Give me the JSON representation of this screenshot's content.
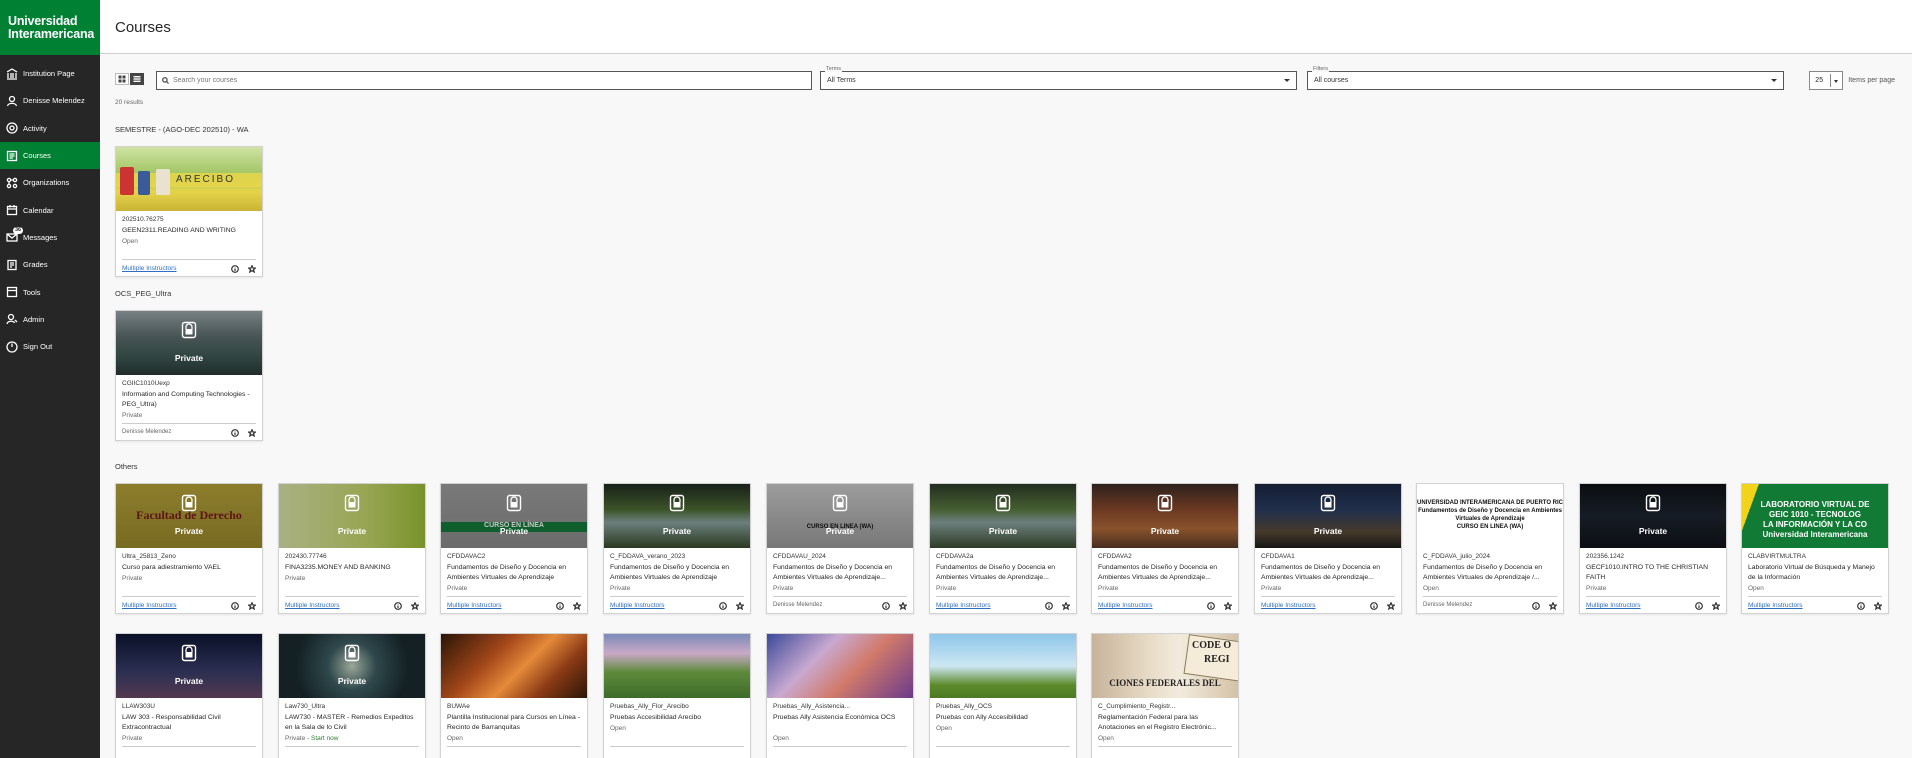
{
  "brand": {
    "line1": "Universidad",
    "line2": "Interamericana"
  },
  "nav": [
    {
      "label": "Institution Page",
      "icon": "institution-icon"
    },
    {
      "label": "Denisse Melendez",
      "icon": "user-icon"
    },
    {
      "label": "Activity",
      "icon": "activity-icon"
    },
    {
      "label": "Courses",
      "icon": "courses-icon",
      "active": true
    },
    {
      "label": "Organizations",
      "icon": "organizations-icon"
    },
    {
      "label": "Calendar",
      "icon": "calendar-icon"
    },
    {
      "label": "Messages",
      "icon": "messages-icon",
      "badge": "36"
    },
    {
      "label": "Grades",
      "icon": "grades-icon"
    },
    {
      "label": "Tools",
      "icon": "tools-icon"
    },
    {
      "label": "Admin",
      "icon": "admin-icon"
    },
    {
      "label": "Sign Out",
      "icon": "sign-out-icon"
    }
  ],
  "header": {
    "title": "Courses"
  },
  "toolbar": {
    "search_placeholder": "Search your courses",
    "terms_label": "Terms",
    "terms_value": "All Terms",
    "filters_label": "Filters",
    "filters_value": "All courses",
    "per_page_value": "25",
    "per_page_label": "Items per page"
  },
  "results": "20 results",
  "sections": {
    "s1": "SEMESTRE - (AGO-DEC 202510) - WA",
    "s2": "OCS_PEG_Ultra",
    "s3": "Others"
  },
  "private_label": "Private",
  "courses": [
    {
      "id": "202510.76275",
      "name": "GEEN2311.READING AND WRITING",
      "status": "Open",
      "instructor": "Multiple Instructors",
      "thumb_text": "ARECIBO"
    },
    {
      "id": "CGIIC1010Uexp",
      "name": "Information and Computing Technologies - PEG_Ultra)",
      "status": "Private",
      "instructor": "Denisse Melendez"
    },
    {
      "id": "Ultra_25813_Zeno",
      "name": "Curso para adiestramiento VAEL",
      "status": "Private",
      "instructor": "Multiple Instructors",
      "thumb_text": "Facultad de Derecho"
    },
    {
      "id": "202430.77746",
      "name": "FINA3235.MONEY AND BANKING",
      "status": "Private",
      "instructor": "Multiple Instructors"
    },
    {
      "id": "CFDDAVAC2",
      "name": "Fundamentos de Diseño y Docencia en Ambientes Virtuales de Aprendizaje",
      "status": "Private",
      "instructor": "Multiple Instructors",
      "thumb_text": "CURSO EN LÍNEA"
    },
    {
      "id": "C_FDDAVA_verano_2023",
      "name": "Fundamentos de Diseño y Docencia en Ambientes Virtuales de Aprendizaje",
      "status": "Private",
      "instructor": "Multiple Instructors"
    },
    {
      "id": "CFDDAVAU_2024",
      "name": "Fundamentos de Diseño y Docencia en Ambientes Virtuales de Aprendizaje...",
      "status": "Private",
      "instructor": "Denisse Melendez",
      "thumb_text": "CURSO EN LINEA (WA)"
    },
    {
      "id": "CFDDAVA2a",
      "name": "Fundamentos de Diseño y Docencia en Ambientes Virtuales de Aprendizaje...",
      "status": "Private",
      "instructor": "Multiple Instructors"
    },
    {
      "id": "CFDDAVA2",
      "name": "Fundamentos de Diseño y Docencia en Ambientes Virtuales de Aprendizaje...",
      "status": "Private",
      "instructor": "Multiple Instructors"
    },
    {
      "id": "CFDDAVA1",
      "name": "Fundamentos de Diseño y Docencia en Ambientes Virtuales de Aprendizaje...",
      "status": "Private",
      "instructor": "Multiple Instructors"
    },
    {
      "id": "C_FDDAVA_julio_2024",
      "name": "Fundamentos de Diseño y Docencia en Ambientes Virtuales de Aprendizaje /...",
      "status": "Open",
      "instructor": "Denisse Melendez",
      "thumb_lines": [
        "UNIVERSIDAD INTERAMERICANA DE PUERTO RICO",
        "Fundamentos de Diseño y Docencia en Ambientes",
        "Virtuales de Aprendizaje",
        "CURSO EN LINEA (WA)"
      ]
    },
    {
      "id": "202356.1242",
      "name": "GECF1010.INTRO TO THE CHRISTIAN FAITH",
      "status": "Private",
      "instructor": "Multiple Instructors"
    },
    {
      "id": "CLABVIRTMULTRA",
      "name": "Laboratorio Virtual de Búsqueda y Manejo de la Información",
      "status": "Open",
      "instructor": "Multiple Instructors",
      "thumb_lines": [
        "LABORATORIO VIRTUAL DE",
        "GEIC 1010 - TECNOLOG",
        "LA INFORMACIÓN Y LA CO",
        "Universidad Interamericana"
      ]
    },
    {
      "id": "LLAW303U",
      "name": "LAW 303 - Responsabilidad Civil Extracontractual",
      "status": "Private"
    },
    {
      "id": "Law730_Ultra",
      "name": "LAW730 - MASTER - Remedios Expeditos en la Sala de lo Civil",
      "status": "Private",
      "status_extra": " - Start now"
    },
    {
      "id": "BUWAe",
      "name": "Plantilla Institucional para Cursos en Línea - Recinto de Barranquitas",
      "status": "Open"
    },
    {
      "id": "Pruebas_Ally_Flor_Arecibo",
      "name": "Pruebas Accesibilidad Arecibo",
      "status": "Open"
    },
    {
      "id": "Pruebas_Ally_Asistencia...",
      "name": "Pruebas Ally Asistencia Económica OCS",
      "status": "Open"
    },
    {
      "id": "Pruebas_Ally_OCS",
      "name": "Pruebas con Ally Accesibilidad",
      "status": "Open"
    },
    {
      "id": "C_Cumplimiento_Registr...",
      "name": "Reglamentación Federal para las Anotaciones en el Registro Electrónic...",
      "status": "Open",
      "thumb_text": "CIONES FEDERALES DEL",
      "thumb_text2": "CODE O",
      "thumb_text3": "REGI"
    }
  ],
  "colors": {
    "brand": "#008033",
    "sidebar": "#262626",
    "link": "#2e6ec2"
  }
}
